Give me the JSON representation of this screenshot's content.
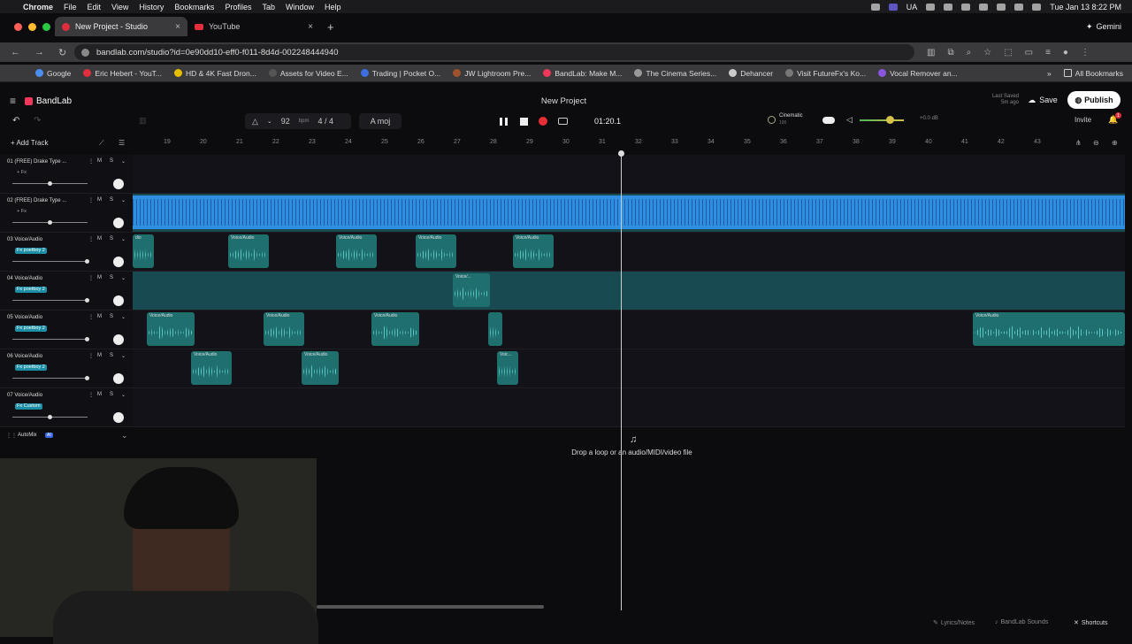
{
  "os_menu": {
    "apple": "",
    "items": [
      "Chrome",
      "File",
      "Edit",
      "View",
      "History",
      "Bookmarks",
      "Profiles",
      "Tab",
      "Window",
      "Help"
    ],
    "lang": "UA",
    "clock": "Tue Jan 13  8:22 PM"
  },
  "browser": {
    "tabs": [
      {
        "title": "New Project - Studio",
        "active": true
      },
      {
        "title": "YouTube",
        "active": false
      }
    ],
    "gemini": "Gemini",
    "url": "bandlab.com/studio?id=0e90dd10-eff0-f011-8d4d-002248444940",
    "bookmarks": [
      "Google",
      "Eric Hebert - YouT...",
      "HD & 4K Fast Dron...",
      "Assets for Video E...",
      "Trading | Pocket O...",
      "JW Lightroom Pre...",
      "BandLab: Make M...",
      "The Cinema Series...",
      "Dehancer",
      "Visit FutureFx's Ko...",
      "Vocal Remover an..."
    ],
    "all_bookmarks": "All Bookmarks"
  },
  "app": {
    "brand": "BandLab",
    "project_title": "New Project",
    "last_saved_1": "Last Saved",
    "last_saved_2": "5m ago",
    "save": "Save",
    "publish": "Publish",
    "invite": "Invite",
    "notif_count": "1"
  },
  "transport": {
    "bpm": "92",
    "bpm_unit": "bpm",
    "time_sig": "4 / 4",
    "key": "A moj",
    "time": "01:20.1",
    "preset": "Cinematic",
    "preset_val": "100",
    "db": "+0.0 dB"
  },
  "add_track": "Add Track",
  "ruler": [
    "19",
    "20",
    "21",
    "22",
    "23",
    "24",
    "25",
    "26",
    "27",
    "28",
    "29",
    "30",
    "31",
    "32",
    "33",
    "34",
    "35",
    "36",
    "37",
    "38",
    "39",
    "40",
    "41",
    "42",
    "43"
  ],
  "tracks": [
    {
      "num": "01",
      "name": "(FREE) Drake Type ...",
      "fx": "+ Fx",
      "fx_style": "plain",
      "vol": 0.5
    },
    {
      "num": "02",
      "name": "(FREE) Drake Type ...",
      "fx": "+ Fx",
      "fx_style": "plain",
      "vol": 0.5
    },
    {
      "num": "03",
      "name": "Voice/Audio",
      "fx": "Fx poetboy 2",
      "fx_style": "teal",
      "vol": 1.0
    },
    {
      "num": "04",
      "name": "Voice/Audio",
      "fx": "Fx poetboy 2",
      "fx_style": "teal",
      "vol": 1.0
    },
    {
      "num": "05",
      "name": "Voice/Audio",
      "fx": "Fx poetboy 2",
      "fx_style": "teal",
      "vol": 1.0
    },
    {
      "num": "06",
      "name": "Voice/Audio",
      "fx": "Fx poetboy 2",
      "fx_style": "teal",
      "vol": 1.0
    },
    {
      "num": "07",
      "name": "Voice/Audio",
      "fx": "Fx Custom",
      "fx_style": "teal",
      "vol": 0.5
    }
  ],
  "track_buttons": {
    "mute": "M",
    "solo": "S"
  },
  "clips": {
    "beat_label": "",
    "t3": [
      {
        "s": 0,
        "l": "dio"
      },
      {
        "s": 108,
        "l": "Voice/Audio"
      },
      {
        "s": 230,
        "l": "Voice/Audio"
      },
      {
        "s": 320,
        "l": "Voice/Audio"
      },
      {
        "s": 430,
        "l": "Voice/Audio"
      }
    ],
    "t4": [
      {
        "s": 362,
        "l": "Voice/..."
      }
    ],
    "t5": [
      {
        "s": 16,
        "l": "Voice/Audio"
      },
      {
        "s": 148,
        "l": "Voice/Audio"
      },
      {
        "s": 270,
        "l": "Voice/Audio"
      },
      {
        "s": 402,
        "l": ""
      },
      {
        "s": 950,
        "l": "Voice/Audio"
      }
    ],
    "t6": [
      {
        "s": 66,
        "l": "Voice/Audio"
      },
      {
        "s": 191,
        "l": "Voice/Audio"
      },
      {
        "s": 412,
        "l": "Voic..."
      }
    ]
  },
  "automix": {
    "label": "AutoMix",
    "ai": "AI"
  },
  "drop_zone": "Drop a loop or an audio/MIDI/video file",
  "footer": {
    "lyrics": "Lyrics/Notes",
    "sounds": "BandLab Sounds",
    "shortcuts": "Shortcuts"
  }
}
